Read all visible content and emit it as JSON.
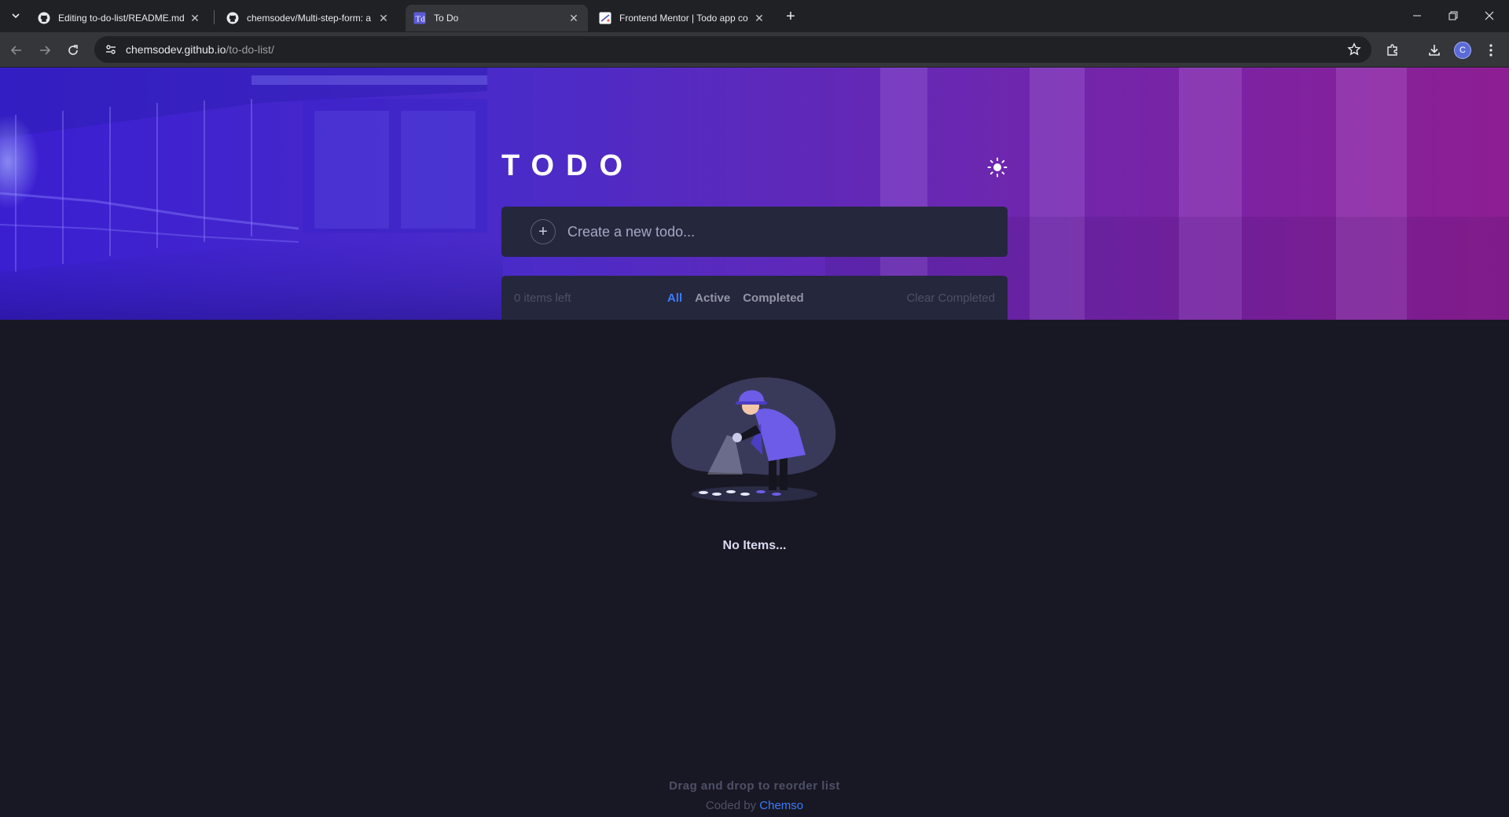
{
  "browser": {
    "tabs": [
      {
        "title": "Editing to-do-list/README.md",
        "icon": "github-icon",
        "active": false
      },
      {
        "title": "chemsodev/Multi-step-form: a",
        "icon": "github-icon",
        "active": false
      },
      {
        "title": "To Do",
        "icon": "todo-favicon",
        "active": true
      },
      {
        "title": "Frontend Mentor | Todo app co",
        "icon": "frontend-mentor-icon",
        "active": false
      }
    ],
    "url_host": "chemsodev.github.io",
    "url_path": "/to-do-list/",
    "profile_initial": "C"
  },
  "app": {
    "title": "TODO",
    "input_placeholder": "Create a new todo...",
    "items_left": "0 items left",
    "filters": [
      "All",
      "Active",
      "Completed"
    ],
    "active_filter": "All",
    "clear_label": "Clear Completed",
    "empty_text": "No Items...",
    "footer_hint": "Drag and drop to reorder list",
    "footer_credit_prefix": "Coded by",
    "footer_credit_name": "Chemso"
  },
  "colors": {
    "accent": "#3a7cfd",
    "card": "#25273d",
    "background": "#181824",
    "gradient_start": "#3a1fd1",
    "gradient_end": "#8e1e93"
  }
}
